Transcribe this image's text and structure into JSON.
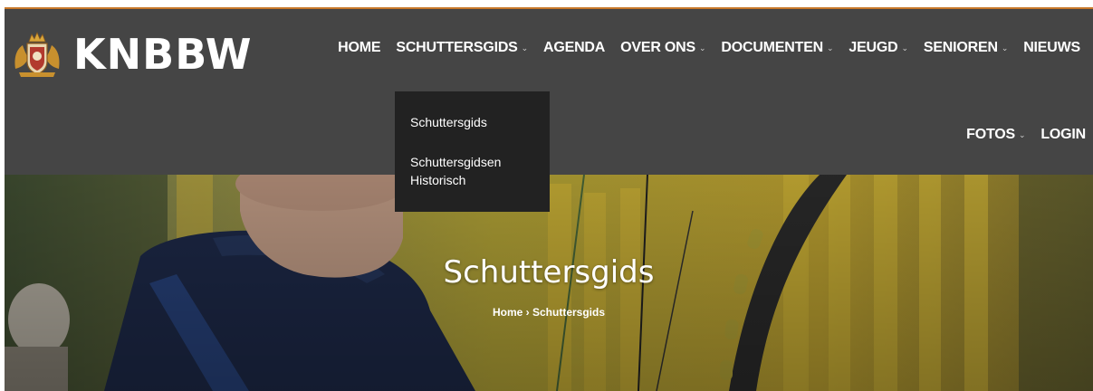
{
  "header": {
    "logo_text": "KNBBW",
    "logo_icon": "crest-emblem-icon"
  },
  "nav": {
    "items": [
      {
        "label": "HOME",
        "has_dropdown": false
      },
      {
        "label": "SCHUTTERSGIDS",
        "has_dropdown": true
      },
      {
        "label": "AGENDA",
        "has_dropdown": false
      },
      {
        "label": "OVER ONS",
        "has_dropdown": true
      },
      {
        "label": "DOCUMENTEN",
        "has_dropdown": true
      },
      {
        "label": "JEUGD",
        "has_dropdown": true
      },
      {
        "label": "SENIOREN",
        "has_dropdown": true
      },
      {
        "label": "NIEUWS",
        "has_dropdown": false
      }
    ],
    "row2": [
      {
        "label": "FOTOS",
        "has_dropdown": true
      },
      {
        "label": "LOGIN",
        "has_dropdown": false
      }
    ],
    "chevron": "⌄"
  },
  "dropdown": {
    "items": [
      {
        "label": "Schuttersgids"
      },
      {
        "label": "Schuttersgidsen Historisch"
      }
    ]
  },
  "hero": {
    "title": "Schuttersgids",
    "breadcrumb": {
      "home": "Home",
      "separator": "›",
      "current": "Schuttersgids"
    }
  },
  "colors": {
    "header_bg": "#454545",
    "accent_line": "#c8782a",
    "dropdown_bg": "#222222"
  }
}
